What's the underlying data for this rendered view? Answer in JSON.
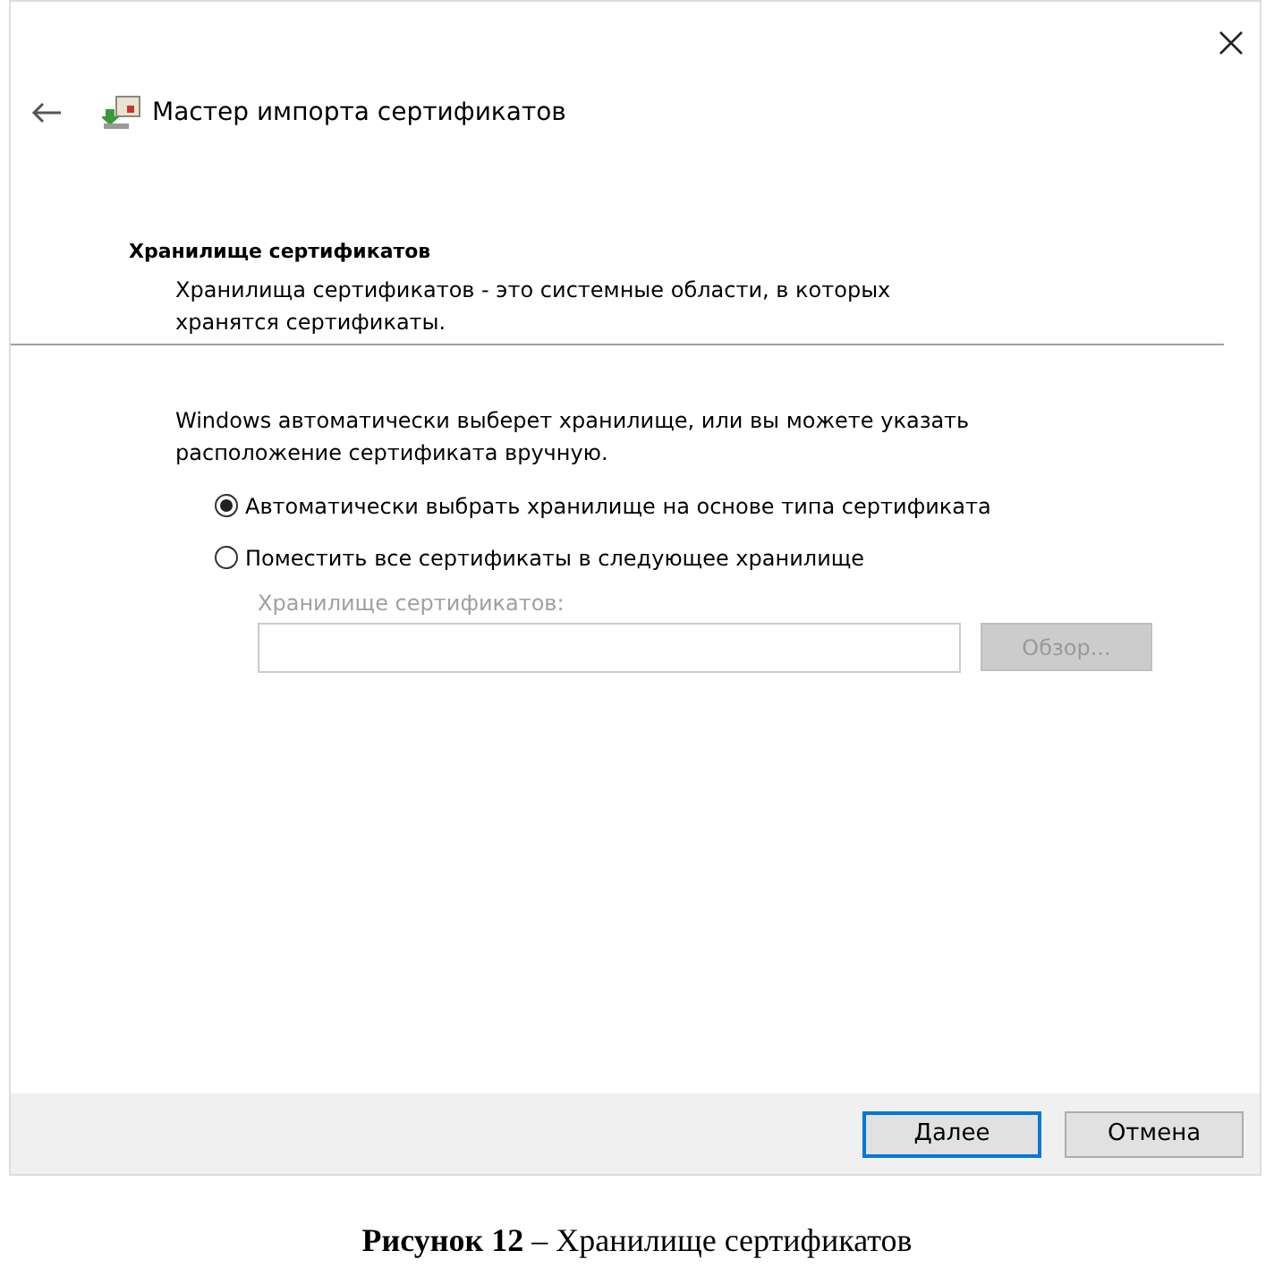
{
  "window": {
    "title": "Мастер импорта сертификатов"
  },
  "section": {
    "heading": "Хранилище сертификатов",
    "description": "Хранилища сертификатов - это системные области, в которых хранятся сертификаты."
  },
  "intro": "Windows автоматически выберет хранилище, или вы можете указать расположение сертификата вручную.",
  "options": [
    {
      "label": "Автоматически выбрать хранилище на основе типа сертификата",
      "selected": true
    },
    {
      "label": "Поместить все сертификаты в следующее хранилище",
      "selected": false
    }
  ],
  "store": {
    "label": "Хранилище сертификатов:",
    "disabled": true,
    "browse": "Обзор..."
  },
  "buttons": [
    {
      "label": "Далее",
      "default": true
    },
    {
      "label": "Отмена",
      "default": false
    }
  ],
  "caption": "**Рисунок 12** – Хранилище сертификатов"
}
